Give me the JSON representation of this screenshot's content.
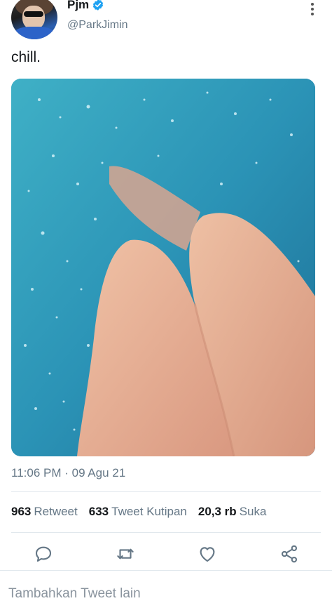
{
  "user": {
    "display_name": "Pjm",
    "handle": "@ParkJimin",
    "verified": true
  },
  "tweet": {
    "text": "chill.",
    "timestamp": "11:06 PM · 09 Agu 21"
  },
  "stats": {
    "retweets": {
      "count": "963",
      "label": "Retweet"
    },
    "quotes": {
      "count": "633",
      "label": "Tweet Kutipan"
    },
    "likes": {
      "count": "20,3 rb",
      "label": "Suka"
    }
  },
  "actions": {
    "reply_icon": "reply-bubble-icon",
    "retweet_icon": "retweet-arrows-icon",
    "like_icon": "heart-icon",
    "share_icon": "share-nodes-icon"
  },
  "reply_bar": {
    "placeholder": "Tambahkan Tweet lain"
  },
  "colors": {
    "verified_blue": "#1da1f2",
    "secondary_text": "#657786",
    "icon_gray": "#657786",
    "water": "#2a8fb0",
    "skin": "#e6b49a"
  }
}
